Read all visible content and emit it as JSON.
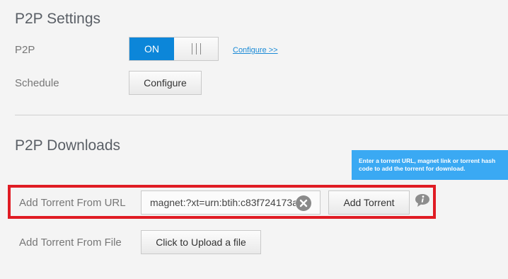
{
  "p2p_settings": {
    "title": "P2P Settings",
    "p2p_label": "P2P",
    "toggle_on_label": "ON",
    "configure_link": "Configure >>",
    "schedule_label": "Schedule",
    "schedule_button": "Configure"
  },
  "p2p_downloads": {
    "title": "P2P Downloads",
    "tooltip_text": "Enter a torrent URL, magnet link or torrent hash code to add the torrent for download.",
    "url_label": "Add Torrent From URL",
    "url_input_value": "magnet:?xt=urn:btih:c83f724173a",
    "add_button": "Add Torrent",
    "file_label": "Add Torrent From File",
    "upload_button": "Click to Upload a file"
  },
  "colors": {
    "accent": "#0c86d9",
    "tooltip": "#3aa9f3",
    "highlight_border": "#e01c24"
  },
  "icons": {
    "clear": "close-circle-icon",
    "info": "info-speech-bubble-icon"
  }
}
